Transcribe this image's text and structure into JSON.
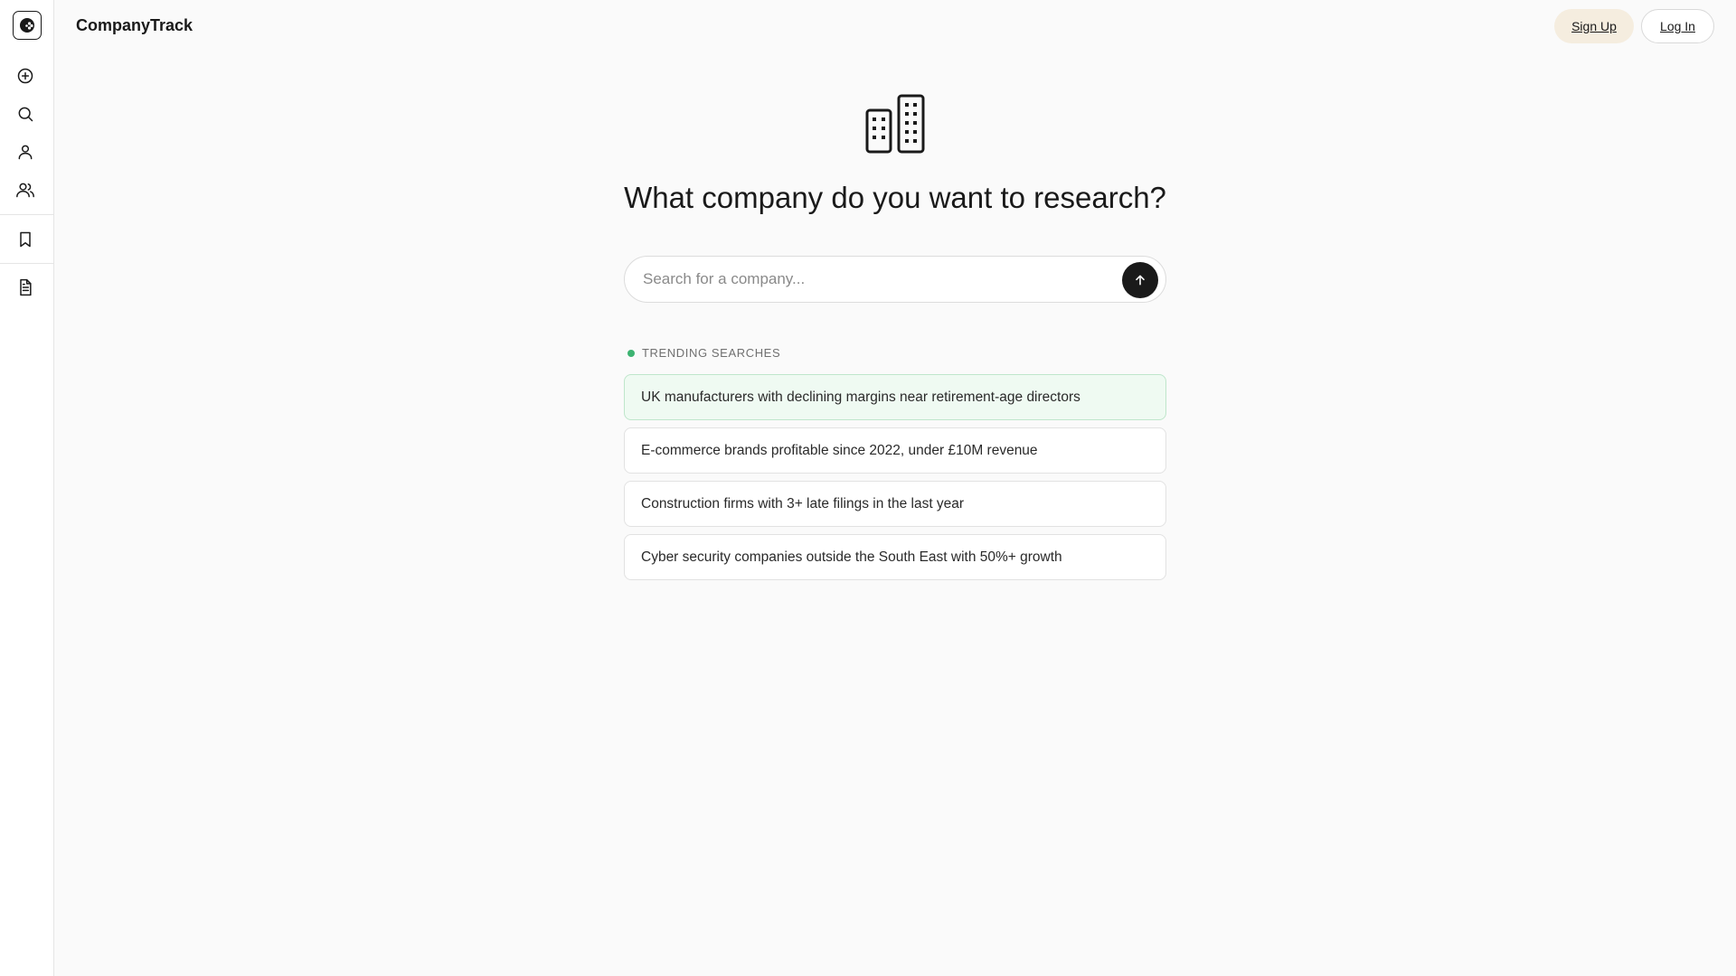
{
  "app": {
    "brand": "CompanyTrack"
  },
  "header": {
    "signup_label": "Sign Up",
    "login_label": "Log In"
  },
  "sidebar": {
    "items": [
      {
        "icon": "plus-circle-icon",
        "label": "New"
      },
      {
        "icon": "search-icon",
        "label": "Search"
      },
      {
        "icon": "user-icon",
        "label": "Profile"
      },
      {
        "icon": "users-icon",
        "label": "People"
      },
      {
        "icon": "bookmark-icon",
        "label": "Saved"
      },
      {
        "icon": "document-icon",
        "label": "Reports"
      }
    ]
  },
  "main": {
    "headline": "What company do you want to research?",
    "search": {
      "placeholder": "Search for a company...",
      "value": ""
    },
    "trending": {
      "label": "TRENDING SEARCHES",
      "items": [
        "UK manufacturers with declining margins near retirement-age directors",
        "E-commerce brands profitable since 2022, under £10M revenue",
        "Construction firms with 3+ late filings in the last year",
        "Cyber security companies outside the South East with 50%+ growth"
      ]
    }
  },
  "colors": {
    "background": "#fafafa",
    "accent_green": "#3cb371",
    "active_suggestion_bg": "#effaf2",
    "signup_bg": "#f5eddf",
    "dark": "#1a1a1a"
  }
}
